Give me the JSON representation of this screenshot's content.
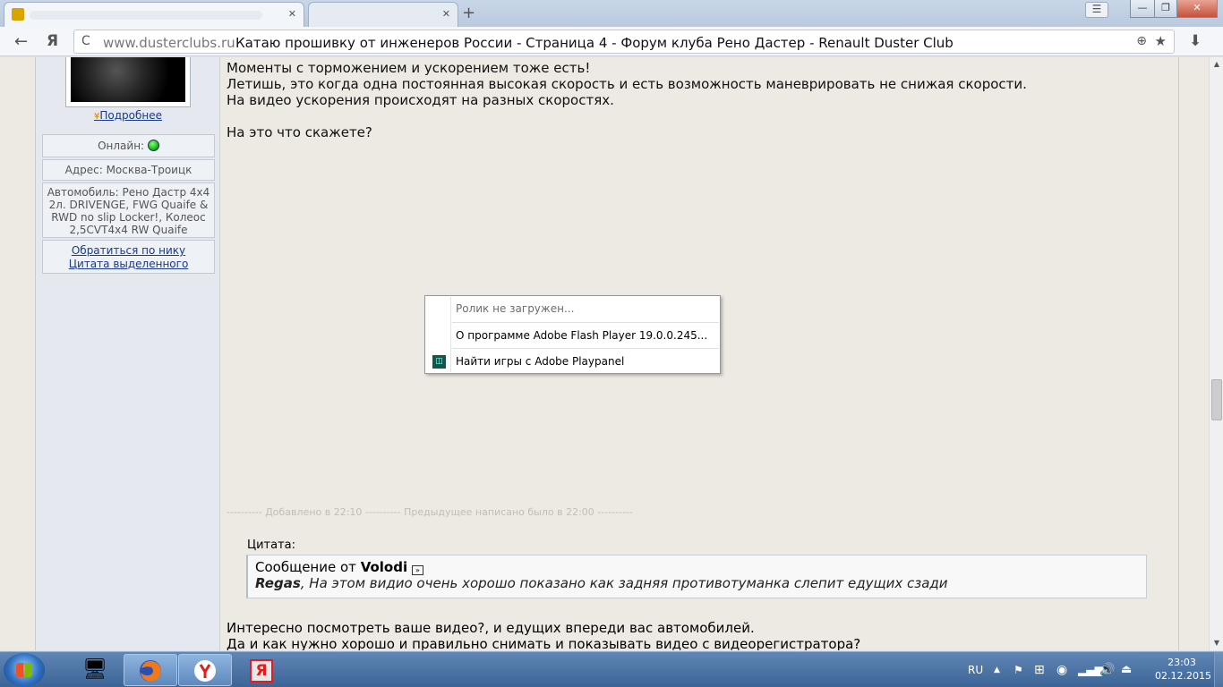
{
  "browser": {
    "tab_new_symbol": "+",
    "window_minimize": "—",
    "window_restore": "❐",
    "window_close": "✕",
    "menu_symbol": "☰",
    "back_symbol": "←",
    "yandex_symbol": "Я",
    "reload_symbol": "C",
    "address_domain": "www.dusterclubs.ru",
    "address_title": "Катаю прошивку от инженеров России - Страница 4 - Форум клуба Рено Дастер - Renault Duster Club",
    "zoom_symbol": "⊕",
    "star_symbol": "★",
    "download_symbol": "⬇"
  },
  "sidebar": {
    "more_link": "Подробнее",
    "online_label": "Онлайн:",
    "address": "Адрес: Москва-Троицк",
    "car_lines": [
      "Автомобиль: Рено Дастр 4x4",
      "2л. DRIVENGE, FWG Quaife &",
      "RWD no slip Locker!, Колеос",
      "2,5CVT4x4 RW Quaife"
    ],
    "action_reply_nick": "Обратиться по нику",
    "action_quote_selected": "Цитата выделенного"
  },
  "post": {
    "lines": [
      "Моменты с торможением и ускорением тоже есть!",
      "Летишь, это когда одна постоянная высокая скорость и есть возможность маневрировать не снижая скорости.",
      "На видео ускорения происходят на разных скоростях.",
      "",
      "На это что скажете?"
    ],
    "separator": "---------- Добавлено в 22:10 ---------- Предыдущее написано было в 22:00 ----------",
    "quote_label": "Цитата:",
    "quote_prefix": "Сообщение от",
    "quote_author": "Volodi",
    "quote_reply_name": "Regas",
    "quote_text": ", На этом видио очень хорошо показано как задняя противотуманка слепит едущих сзади",
    "after_lines": [
      "Интересно посмотреть ваше видео?, и едущих впереди вас автомобилей.",
      "Да и как нужно хорошо и правильно снимать и показывать видео с видеорегистратора?"
    ]
  },
  "context_menu": {
    "item1": "Ролик не загружен...",
    "item2": "О программе Adobe Flash Player 19.0.0.245...",
    "item3": "Найти игры с Adobe Playpanel"
  },
  "taskbar": {
    "lang": "RU",
    "time": "23:03",
    "date": "02.12.2015",
    "yandex_letter": "Я"
  }
}
